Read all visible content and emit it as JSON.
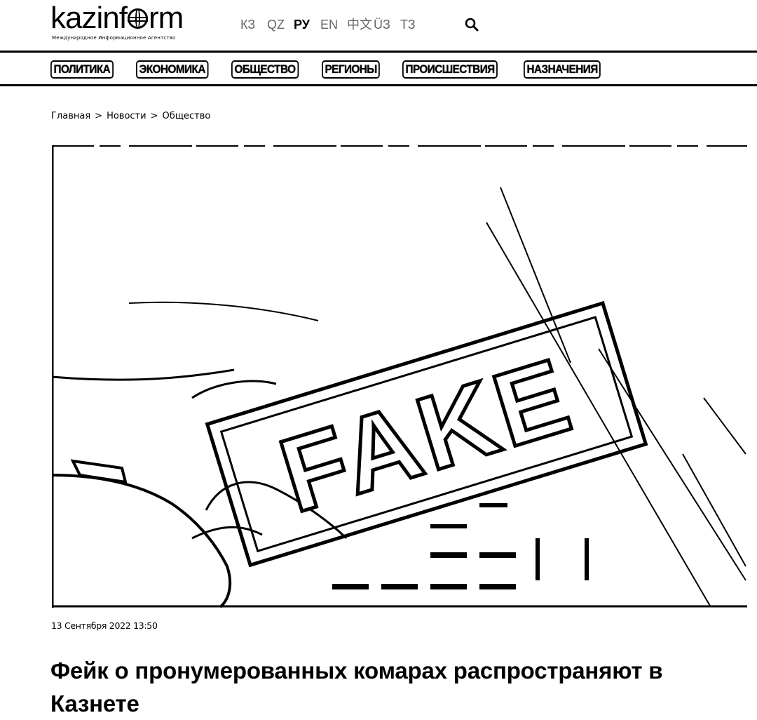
{
  "header": {
    "logo_text_before": "kazinf",
    "logo_text_after": "rm",
    "logo_tagline": "Международное Информационное Агентство",
    "languages": [
      {
        "label": "КЗ",
        "active": false
      },
      {
        "label": "QZ",
        "active": false
      },
      {
        "label": "РУ",
        "active": true
      },
      {
        "label": "EN",
        "active": false
      },
      {
        "label": "中文",
        "active": false
      },
      {
        "label": "ÜЗ",
        "active": false
      },
      {
        "label": "ТЗ",
        "active": false
      }
    ],
    "search_icon": "search-icon"
  },
  "nav": {
    "items": [
      "ПОЛИТИКА",
      "ЭКОНОМИКА",
      "ОБЩЕСТВО",
      "РЕГИОНЫ",
      "ПРОИСШЕСТВИЯ",
      "НАЗНАЧЕНИЯ"
    ]
  },
  "breadcrumb": {
    "items": [
      "Главная",
      "Новости",
      "Общество"
    ],
    "separator": ">"
  },
  "article": {
    "image_text": "FAKE",
    "date": "13 Сентября 2022 13:50",
    "title": "Фейк о пронумерованных комарах распространяют в Казнете"
  }
}
